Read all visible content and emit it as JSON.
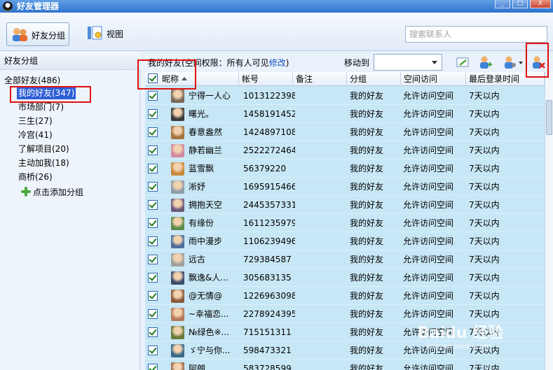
{
  "window": {
    "title": "好友管理器",
    "minimize": "_",
    "maximize": "□",
    "close": "X"
  },
  "toolbar": {
    "group_button": "好友分组",
    "view_button": "视图",
    "search_placeholder": "搜索联系人"
  },
  "sidebar": {
    "header": "好友分组",
    "root": "全部好友(486)",
    "groups": [
      {
        "label": "我的好友(347)",
        "selected": true
      },
      {
        "label": "市场部门(7)"
      },
      {
        "label": "三生(27)"
      },
      {
        "label": "冷宫(41)"
      },
      {
        "label": "了解项目(20)"
      },
      {
        "label": "主动加我(18)"
      },
      {
        "label": "商桥(26)"
      }
    ],
    "add_group": "点击添加分组"
  },
  "main": {
    "permission_prefix": "我的好友(空间权限：所有人可见",
    "permission_link": "修改",
    "permission_suffix": ")",
    "move_to_label": "移动到",
    "columns": [
      "昵称",
      "帐号",
      "备注",
      "分组",
      "空间访问",
      "最后登录时间"
    ],
    "rows": [
      {
        "nick": "宁得一人心",
        "account": "1013122398",
        "note": "",
        "group": "我的好友",
        "space": "允许访问空间",
        "last": "7天以内"
      },
      {
        "nick": "曙光。",
        "account": "1458191452",
        "note": "",
        "group": "我的好友",
        "space": "允许访问空间",
        "last": "7天以内"
      },
      {
        "nick": "春意盎然",
        "account": "1424897108",
        "note": "",
        "group": "我的好友",
        "space": "允许访问空间",
        "last": "7天以内"
      },
      {
        "nick": "静若幽兰",
        "account": "2522272464",
        "note": "",
        "group": "我的好友",
        "space": "允许访问空间",
        "last": "7天以内"
      },
      {
        "nick": "蓝雪飘",
        "account": "56379220",
        "note": "",
        "group": "我的好友",
        "space": "允许访问空间",
        "last": "7天以内"
      },
      {
        "nick": "淅妤",
        "account": "1695915466",
        "note": "",
        "group": "我的好友",
        "space": "允许访问空间",
        "last": "7天以内"
      },
      {
        "nick": "拥抱天空",
        "account": "2445357331",
        "note": "",
        "group": "我的好友",
        "space": "允许访问空间",
        "last": "7天以内"
      },
      {
        "nick": "有缘份",
        "account": "1611235979",
        "note": "",
        "group": "我的好友",
        "space": "允许访问空间",
        "last": "7天以内"
      },
      {
        "nick": "雨中漫步",
        "account": "1106239496",
        "note": "",
        "group": "我的好友",
        "space": "允许访问空间",
        "last": "7天以内"
      },
      {
        "nick": "远古",
        "account": "729384587",
        "note": "",
        "group": "我的好友",
        "space": "允许访问空间",
        "last": "7天以内"
      },
      {
        "nick": "飘逸&人...",
        "account": "305683135",
        "note": "",
        "group": "我的好友",
        "space": "允许访问空间",
        "last": "7天以内"
      },
      {
        "nick": "@无情@",
        "account": "1226963098",
        "note": "",
        "group": "我的好友",
        "space": "允许访问空间",
        "last": "7天以内"
      },
      {
        "nick": "~幸福恋...",
        "account": "2278924395",
        "note": "",
        "group": "我的好友",
        "space": "允许访问空间",
        "last": "7天以内"
      },
      {
        "nick": "№绿色※...",
        "account": "715151311",
        "note": "",
        "group": "我的好友",
        "space": "允许访问空间",
        "last": "7天以内"
      },
      {
        "nick": "ゞ宁与你...",
        "account": "598473321",
        "note": "",
        "group": "我的好友",
        "space": "允许访问空间",
        "last": "7天以内"
      },
      {
        "nick": "阿朗",
        "account": "583728599",
        "note": "",
        "group": "我的好友",
        "space": "允许访问空间",
        "last": "7天以内"
      }
    ]
  },
  "watermark": {
    "brand": "Baidu 经验",
    "sub": "jingyan.baidu.com"
  },
  "colors": {
    "row_bg": "#c8e7f6",
    "selected_group": "#2f5fd6",
    "highlight": "#e01010",
    "link": "#1a4fc4"
  }
}
